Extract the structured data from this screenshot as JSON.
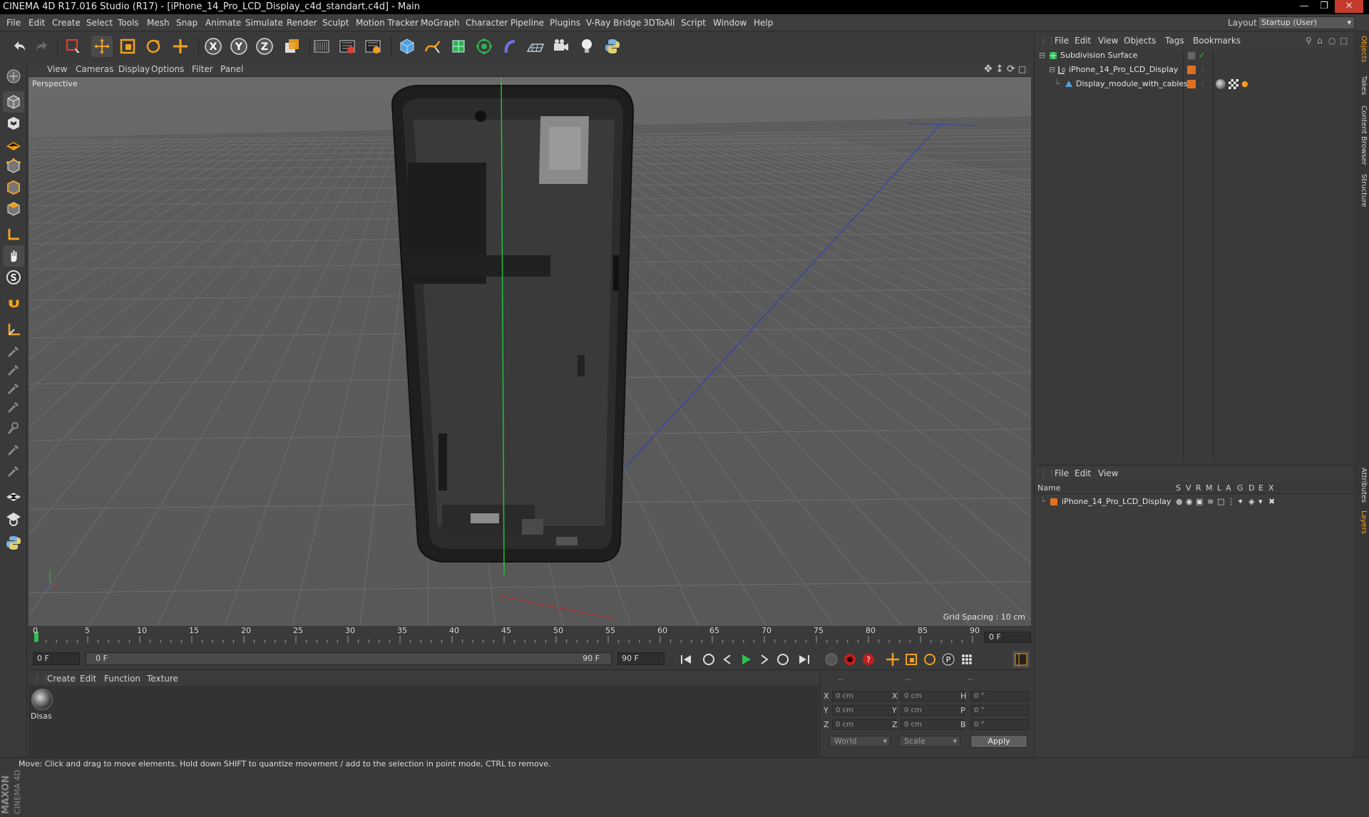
{
  "window": {
    "title": "CINEMA 4D R17.016 Studio (R17) - [iPhone_14_Pro_LCD_Display_c4d_standart.c4d] - Main"
  },
  "menubar": {
    "items": [
      "File",
      "Edit",
      "Create",
      "Select",
      "Tools",
      "Mesh",
      "Snap",
      "Animate",
      "Simulate",
      "Render",
      "Sculpt",
      "Motion Tracker",
      "MoGraph",
      "Character",
      "Pipeline",
      "Plugins",
      "V-Ray Bridge",
      "3DToAll",
      "Script",
      "Window",
      "Help"
    ],
    "layout_label": "Layout:",
    "layout_value": "Startup (User)"
  },
  "toolbar": {
    "icons": [
      "undo-icon",
      "redo-icon",
      "live-selection-icon",
      "move-icon",
      "scale-icon",
      "rotate-icon",
      "add-icon",
      "x-axis-icon",
      "y-axis-icon",
      "z-axis-icon",
      "coordinate-system-icon",
      "render-view-icon",
      "render-picture-viewer-icon",
      "edit-render-settings-icon",
      "cube-icon",
      "pen-spline-icon",
      "subdivision-icon",
      "cloner-icon",
      "deformer-icon",
      "floor-icon",
      "camera-icon",
      "light-icon",
      "python-icon"
    ]
  },
  "viewport": {
    "menu": [
      "View",
      "Cameras",
      "Display",
      "Options",
      "Filter",
      "Panel"
    ],
    "label": "Perspective",
    "grid_spacing": "Grid Spacing : 10 cm"
  },
  "timeline": {
    "ticks": [
      "0",
      "5",
      "10",
      "15",
      "20",
      "25",
      "30",
      "35",
      "40",
      "45",
      "50",
      "55",
      "60",
      "65",
      "70",
      "75",
      "80",
      "85",
      "90"
    ],
    "current_frame": "0 F"
  },
  "transport": {
    "start_frame": "0 F",
    "range_start": "0 F",
    "range_end": "90 F",
    "end_frame": "90 F"
  },
  "material_manager": {
    "menu": [
      "Create",
      "Edit",
      "Function",
      "Texture"
    ],
    "material_name": "Disas"
  },
  "coordinates": {
    "header": [
      "--",
      "--",
      "--"
    ],
    "rows": [
      {
        "axis": "X",
        "pos": "0 cm",
        "size_axis": "X",
        "size": "0 cm",
        "rot_axis": "H",
        "rot": "0 °"
      },
      {
        "axis": "Y",
        "pos": "0 cm",
        "size_axis": "Y",
        "size": "0 cm",
        "rot_axis": "P",
        "rot": "0 °"
      },
      {
        "axis": "Z",
        "pos": "0 cm",
        "size_axis": "Z",
        "size": "0 cm",
        "rot_axis": "B",
        "rot": "0 °"
      }
    ],
    "space": "World",
    "mode": "Scale",
    "apply_label": "Apply"
  },
  "object_manager": {
    "menu": [
      "File",
      "Edit",
      "View",
      "Objects",
      "Tags",
      "Bookmarks"
    ],
    "objects": [
      {
        "name": "Subdivision Surface",
        "indent": 0
      },
      {
        "name": "iPhone_14_Pro_LCD_Display",
        "indent": 1
      },
      {
        "name": "Display_module_with_cables",
        "indent": 2
      }
    ]
  },
  "layer_manager": {
    "menu": [
      "File",
      "Edit",
      "View"
    ],
    "columns": [
      "Name",
      "S",
      "V",
      "R",
      "M",
      "L",
      "A",
      "G",
      "D",
      "E",
      "X"
    ],
    "layer_name": "iPhone_14_Pro_LCD_Display"
  },
  "right_tabs": [
    "Objects",
    "Takes",
    "Content Browser",
    "Structure",
    "Attributes",
    "Layers"
  ],
  "status": {
    "text": "Move: Click and drag to move elements. Hold down SHIFT to quantize movement / add to the selection in point mode, CTRL to remove."
  },
  "colors": {
    "accent": "#f0a020",
    "layer": "#e07020",
    "viewport_bg": "#5c5c5c"
  }
}
